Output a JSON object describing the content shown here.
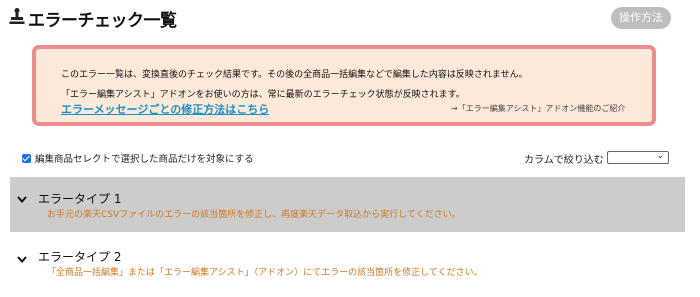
{
  "header": {
    "title": "エラーチェック一覧",
    "icon": "stamp-icon",
    "ops_button": "操作方法"
  },
  "notice": {
    "line1": "このエラー一覧は、変換直後のチェック結果です。その後の全商品一括編集などで編集した内容は反映されません。",
    "line2": "「エラー編集アシスト」アドオンをお使いの方は、常に最新のエラーチェック状態が反映されます。",
    "link": "エラーメッセージごとの修正方法はこちら",
    "addon_link": "→「エラー編集アシスト」アドオン機能のご紹介"
  },
  "filter": {
    "checkbox_label": "編集商品セレクトで選択した商品だけを対象にする",
    "checkbox_checked": true,
    "column_filter_label": "カラムで絞り込む",
    "column_filter_value": ""
  },
  "errors": [
    {
      "title": "エラータイプ 1",
      "description": "お手元の楽天CSVファイルのエラーの該当箇所を修正し、再度楽天データ取込から実行してください。"
    },
    {
      "title": "エラータイプ 2",
      "description": "「全商品一括編集」または「エラー編集アシスト」（アドオン）にてエラーの該当箇所を修正してください。"
    }
  ],
  "colors": {
    "notice_bg": "#fde9d9",
    "notice_border": "#ec8c8c",
    "link": "#1a8fc7",
    "error_desc": "#cc7a20",
    "error_header_bg": "#cccccc",
    "ops_button_bg": "#bdbdbd"
  }
}
